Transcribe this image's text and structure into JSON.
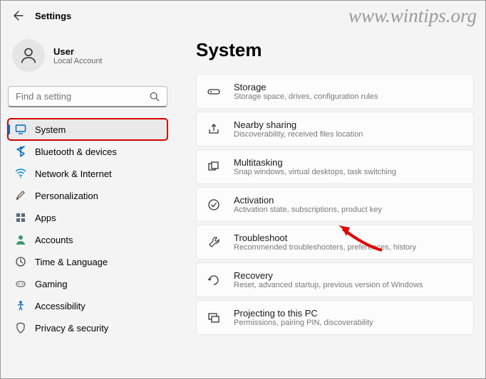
{
  "watermark": "www.wintips.org",
  "header": {
    "title": "Settings"
  },
  "user": {
    "name": "User",
    "sub": "Local Account"
  },
  "search": {
    "placeholder": "Find a setting"
  },
  "sidebar": {
    "items": [
      {
        "label": "System"
      },
      {
        "label": "Bluetooth & devices"
      },
      {
        "label": "Network & Internet"
      },
      {
        "label": "Personalization"
      },
      {
        "label": "Apps"
      },
      {
        "label": "Accounts"
      },
      {
        "label": "Time & Language"
      },
      {
        "label": "Gaming"
      },
      {
        "label": "Accessibility"
      },
      {
        "label": "Privacy & security"
      }
    ]
  },
  "page": {
    "title": "System"
  },
  "cards": [
    {
      "title": "Storage",
      "sub": "Storage space, drives, configuration rules"
    },
    {
      "title": "Nearby sharing",
      "sub": "Discoverability, received files location"
    },
    {
      "title": "Multitasking",
      "sub": "Snap windows, virtual desktops, task switching"
    },
    {
      "title": "Activation",
      "sub": "Activation state, subscriptions, product key"
    },
    {
      "title": "Troubleshoot",
      "sub": "Recommended troubleshooters, preferences, history"
    },
    {
      "title": "Recovery",
      "sub": "Reset, advanced startup, previous version of Windows"
    },
    {
      "title": "Projecting to this PC",
      "sub": "Permissions, pairing PIN, discoverability"
    }
  ]
}
